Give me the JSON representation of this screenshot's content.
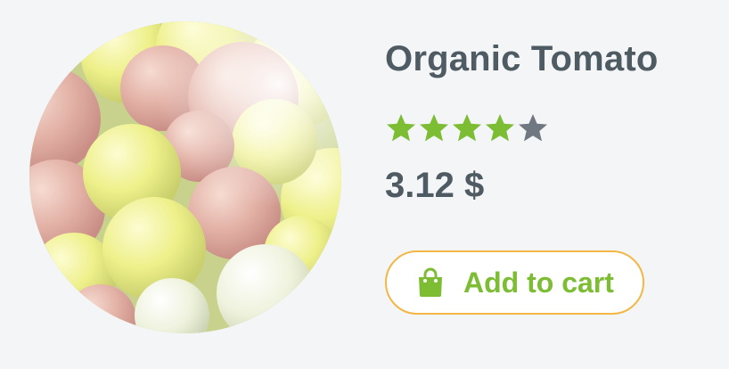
{
  "product": {
    "title": "Organic Tomato",
    "rating": {
      "value": 4,
      "max": 5
    },
    "price": "3.12 $",
    "add_to_cart_label": "Add to cart"
  },
  "colors": {
    "text": "#4e5b62",
    "star_filled": "#7cbd33",
    "star_empty": "#6f7781",
    "button_border": "#f2b746",
    "button_text": "#7cbd33",
    "background": "#f4f5f7"
  },
  "icons": {
    "rating": "star-icon",
    "cart": "shopping-bag-icon"
  }
}
